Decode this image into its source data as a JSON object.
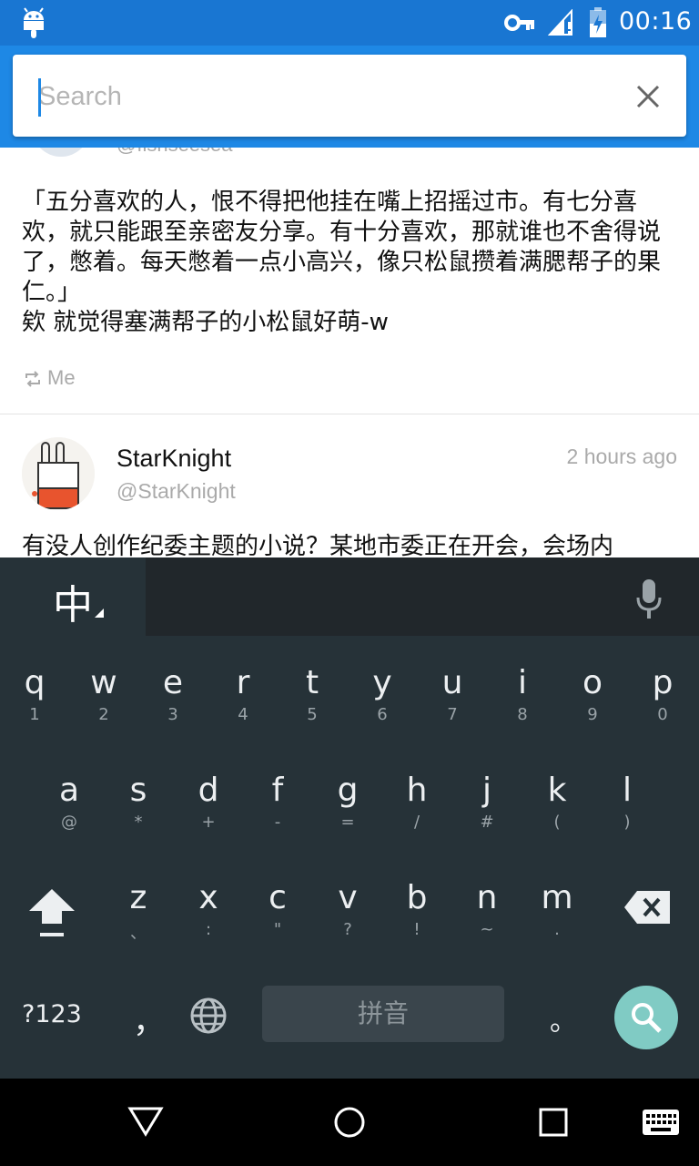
{
  "status_bar": {
    "time": "00:16",
    "icons": [
      "android-icon",
      "vpn-key-icon",
      "signal-icon",
      "battery-charging-icon"
    ]
  },
  "search": {
    "placeholder": "Search",
    "value": "",
    "clear_icon": "close-icon"
  },
  "feed": {
    "partial_post": {
      "handle": "@fishseesea",
      "text": "「五分喜欢的人，恨不得把他挂在嘴上招摇过市。有七分喜欢，就只能跟至亲密友分享。有十分喜欢，那就谁也不舍得说了，憋着。每天憋着一点小高兴，像只松鼠攒着满腮帮子的果仁。」\n欸 就觉得塞满帮子的小松鼠好萌-w",
      "retweeted_by": "Me"
    },
    "post": {
      "username": "StarKnight",
      "handle": "@StarKnight",
      "time": "2 hours ago",
      "text": "有没人创作纪委主题的小说？某地市委正在开会，会场内"
    }
  },
  "keyboard": {
    "language_label": "中",
    "row1": [
      {
        "key": "q",
        "sub": "1"
      },
      {
        "key": "w",
        "sub": "2"
      },
      {
        "key": "e",
        "sub": "3"
      },
      {
        "key": "r",
        "sub": "4"
      },
      {
        "key": "t",
        "sub": "5"
      },
      {
        "key": "y",
        "sub": "6"
      },
      {
        "key": "u",
        "sub": "7"
      },
      {
        "key": "i",
        "sub": "8"
      },
      {
        "key": "o",
        "sub": "9"
      },
      {
        "key": "p",
        "sub": "0"
      }
    ],
    "row2": [
      {
        "key": "a",
        "sub": "@"
      },
      {
        "key": "s",
        "sub": "*"
      },
      {
        "key": "d",
        "sub": "+"
      },
      {
        "key": "f",
        "sub": "-"
      },
      {
        "key": "g",
        "sub": "="
      },
      {
        "key": "h",
        "sub": "/"
      },
      {
        "key": "j",
        "sub": "#"
      },
      {
        "key": "k",
        "sub": "("
      },
      {
        "key": "l",
        "sub": ")"
      }
    ],
    "row3": [
      {
        "key": "z",
        "sub": "、"
      },
      {
        "key": "x",
        "sub": ":"
      },
      {
        "key": "c",
        "sub": "\""
      },
      {
        "key": "v",
        "sub": "?"
      },
      {
        "key": "b",
        "sub": "!"
      },
      {
        "key": "n",
        "sub": "~"
      },
      {
        "key": "m",
        "sub": "."
      }
    ],
    "symbols_key": "?123",
    "comma_key": "，",
    "space_label": "拼音",
    "period_key": "。"
  }
}
